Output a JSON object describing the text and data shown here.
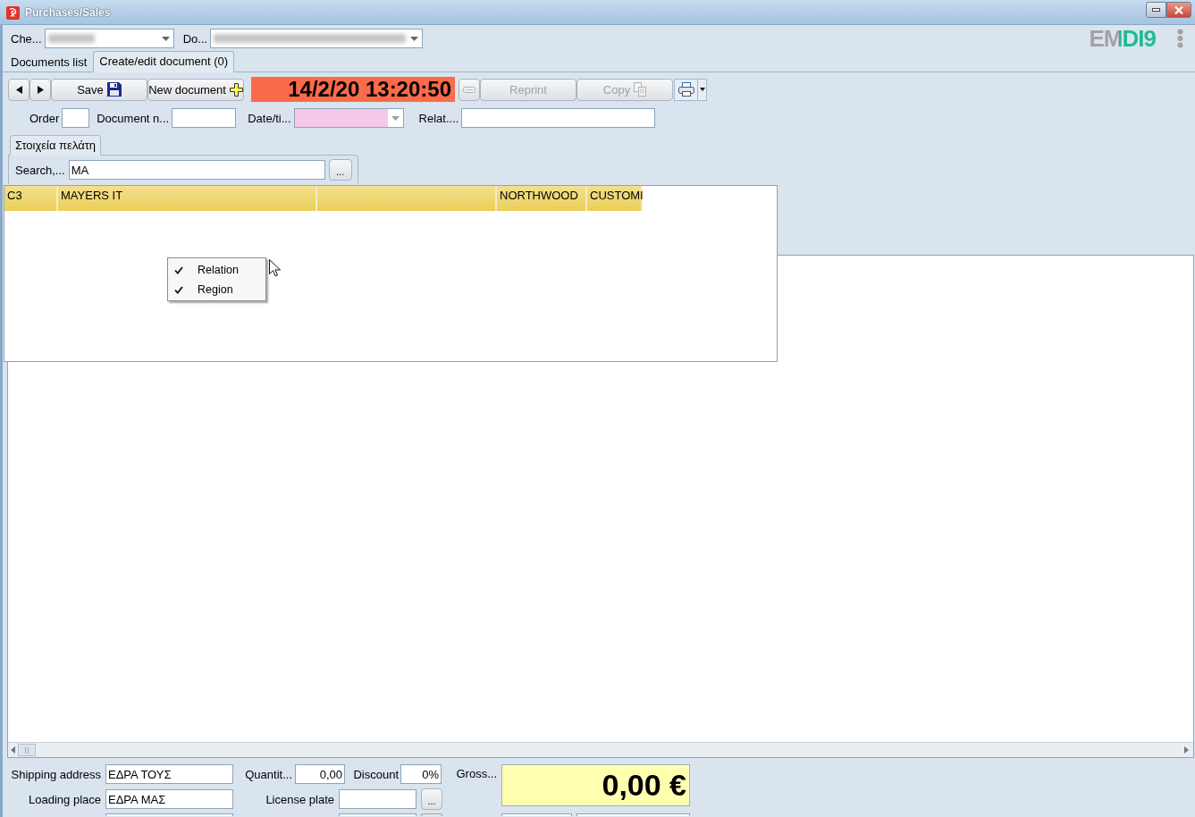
{
  "window": {
    "title": "Purchases/Sales"
  },
  "header": {
    "selectors": [
      {
        "label": "Che..."
      },
      {
        "label": "Do..."
      }
    ],
    "logo": "EMDI9"
  },
  "tabs": [
    {
      "label": "Documents list",
      "selected": false
    },
    {
      "label": "Create/edit document (0)",
      "selected": true
    }
  ],
  "toolbar": {
    "buttons": [
      {
        "kind": "previous",
        "disabled": false
      },
      {
        "kind": "next",
        "disabled": false
      },
      {
        "kind": "save",
        "label": "Save",
        "disabled": false
      },
      {
        "kind": "new",
        "label": "New document",
        "disabled": false
      }
    ],
    "clock": "14/2/20 13:20:50",
    "actions": [
      {
        "kind": "remove",
        "disabled": true
      },
      {
        "kind": "reprint",
        "label": "Reprint",
        "disabled": true
      },
      {
        "kind": "copy",
        "label": "Copy",
        "disabled": true
      },
      {
        "kind": "print",
        "disabled": false
      }
    ]
  },
  "fields": [
    {
      "label": "Order",
      "kind": "text"
    },
    {
      "label": "Document n...",
      "kind": "text"
    },
    {
      "label": "Date/ti...",
      "kind": "combo",
      "highlighted": true
    },
    {
      "label": "Relat....",
      "kind": "text"
    }
  ],
  "customer_tabs": [
    {
      "label": "Στοιχεία πελάτη",
      "selected": true
    }
  ],
  "search": {
    "label": "Search,...",
    "value": "MA",
    "button": "..."
  },
  "results": {
    "rows": [
      {
        "selected": true,
        "cells": [
          {
            "text": "C3"
          },
          {
            "text": "MAYERS IT"
          },
          {},
          {
            "text": "NORTHWOOD"
          },
          {
            "text": "CUSTOMI"
          }
        ]
      }
    ]
  },
  "context_menu": {
    "items": [
      {
        "label": "Relation",
        "checked": true
      },
      {
        "label": "Region",
        "checked": true
      }
    ]
  },
  "footer": {
    "shipping_address": {
      "label": "Shipping address",
      "value": "ΕΔΡΑ ΤΟΥΣ"
    },
    "quantity": {
      "label": "Quantit...",
      "value": "0,00"
    },
    "discount": {
      "label": "Discount",
      "value": "0%"
    },
    "gross": {
      "label": "Gross...",
      "value": "0,00 €"
    },
    "loading_place": {
      "label": "Loading place",
      "value": "ΕΔΡΑ ΜΑΣ"
    },
    "license_plate": {
      "label": "License plate",
      "button": "..."
    },
    "partial_row": [
      {
        "kind": "field"
      },
      {
        "kind": "field"
      },
      {
        "kind": "button"
      },
      {
        "kind": "field"
      },
      {
        "kind": "field"
      }
    ]
  }
}
